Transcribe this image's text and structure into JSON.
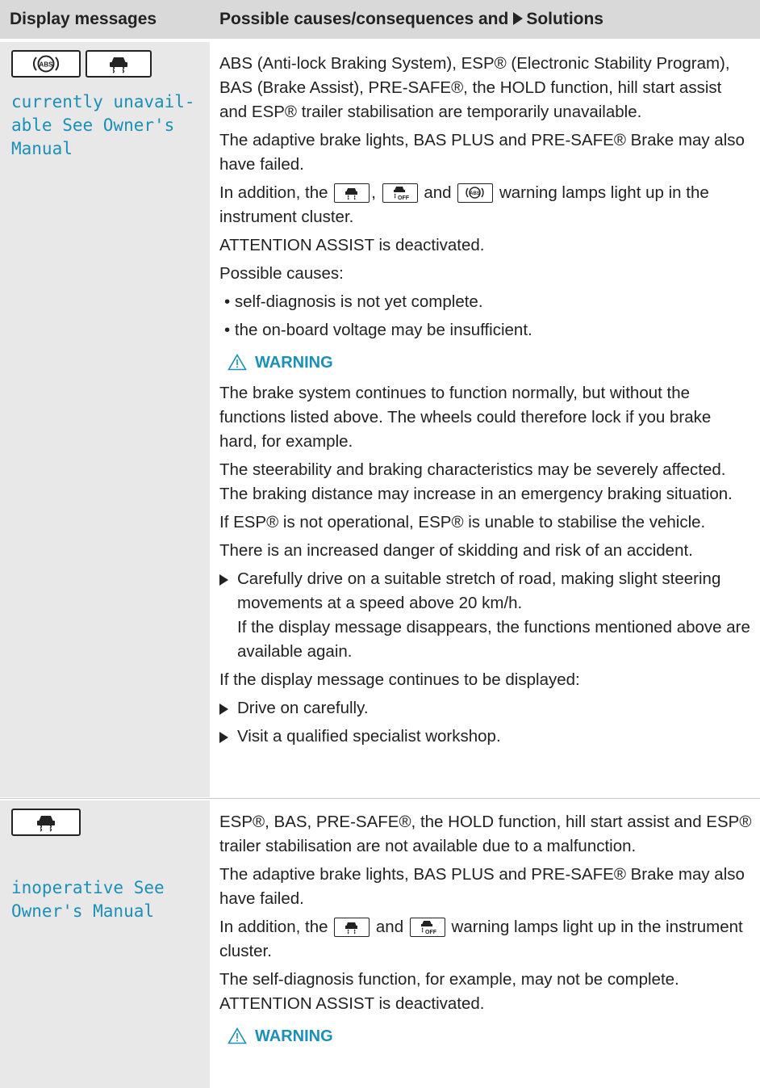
{
  "header": {
    "col1": "Display messages",
    "col2_prefix": "Possible causes/consequences and",
    "col2_suffix": "Solutions"
  },
  "icons": {
    "abs": "abs-warning-icon",
    "esp": "esp-skid-icon",
    "esp_off": "esp-off-icon",
    "warning": "warning-triangle-icon"
  },
  "colors": {
    "accent": "#1a8fb8",
    "header_bg": "#d9d9d9",
    "left_col_bg": "#e8e8e8"
  },
  "row1": {
    "display": "currently unavail-\nable See Owner's\nManual",
    "p1": "ABS (Anti-lock Braking System), ESP® (Electronic Stability Program), BAS (Brake Assist), PRE-SAFE®, the HOLD function, hill start assist and ESP® trailer stabilisation are temporarily unavailable.",
    "p2": "The adaptive brake lights, BAS PLUS and PRE-SAFE® Brake may also have failed.",
    "p3_a": "In addition, the",
    "p3_b": ",",
    "p3_c": "and",
    "p3_d": "warning lamps light up in the instrument cluster.",
    "p4": "ATTENTION ASSIST is deactivated.",
    "p5": "Possible causes:",
    "bullets": [
      "• self-diagnosis is not yet complete.",
      "• the on-board voltage may be insufficient."
    ],
    "warning_label": "WARNING",
    "w1": "The brake system continues to function normally, but without the functions listed above. The wheels could therefore lock if you brake hard, for example.",
    "w2": "The steerability and braking characteristics may be severely affected. The braking distance may increase in an emergency braking situation.",
    "w3": "If ESP® is not operational, ESP® is unable to stabilise the vehicle.",
    "w4": "There is an increased danger of skidding and risk of an accident.",
    "step1": "Carefully drive on a suitable stretch of road, making slight steering movements at a speed above 20 km/h.",
    "step1_sub": "If the display message disappears, the functions mentioned above are available again.",
    "p6": "If the display message continues to be displayed:",
    "step2": "Drive on carefully.",
    "step3": "Visit a qualified specialist workshop."
  },
  "row2": {
    "display": "inoperative See\nOwner's Manual",
    "p1": "ESP®, BAS, PRE-SAFE®, the HOLD function, hill start assist and ESP® trailer stabilisation are not available due to a malfunction.",
    "p2": "The adaptive brake lights, BAS PLUS and PRE-SAFE® Brake may also have failed.",
    "p3_a": "In addition, the",
    "p3_c": "and",
    "p3_d": "warning lamps light up in the instrument cluster.",
    "p4": "The self-diagnosis function, for example, may not be complete.",
    "p5": "ATTENTION ASSIST is deactivated.",
    "warning_label": "WARNING"
  }
}
